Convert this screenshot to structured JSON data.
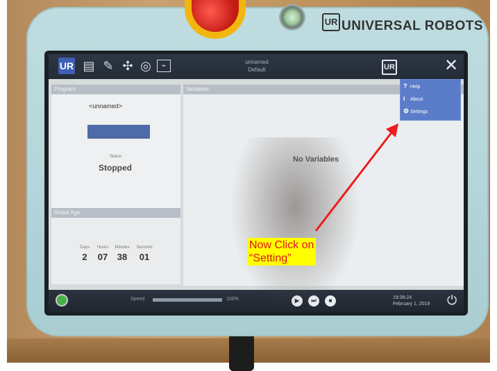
{
  "brand": {
    "logo_text": "UR",
    "name": "UNIVERSAL ROBOTS"
  },
  "topbar": {
    "home_icon_text": "UR",
    "center_lines": [
      "unnamed",
      "Default"
    ],
    "right_ur_text": "UR",
    "close_glyph": "✕"
  },
  "program_panel": {
    "header": "Program",
    "name": "<unnamed>",
    "status_label": "Status",
    "status_value": "Stopped"
  },
  "variables_panel": {
    "header": "Variables",
    "empty_text": "No Variables"
  },
  "robot_age": {
    "header": "Robot Age",
    "columns": [
      {
        "label": "Days",
        "value": "2"
      },
      {
        "label": "Hours",
        "value": "07"
      },
      {
        "label": "Minutes",
        "value": "38"
      },
      {
        "label": "Seconds",
        "value": "01"
      }
    ]
  },
  "menu": {
    "items": [
      {
        "icon": "?",
        "label": "Help"
      },
      {
        "icon": "i",
        "label": "About"
      },
      {
        "icon": "⚙",
        "label": "Settings"
      }
    ]
  },
  "bottombar": {
    "speed_label": "Speed",
    "speed_value": "100%",
    "speed_fraction": 1.0,
    "time": "19:38:24",
    "date": "February 1, 2019"
  },
  "annotation": {
    "line1": "Now Click on",
    "line2": "“Setting”",
    "arrow_color": "#ee1c1c"
  }
}
